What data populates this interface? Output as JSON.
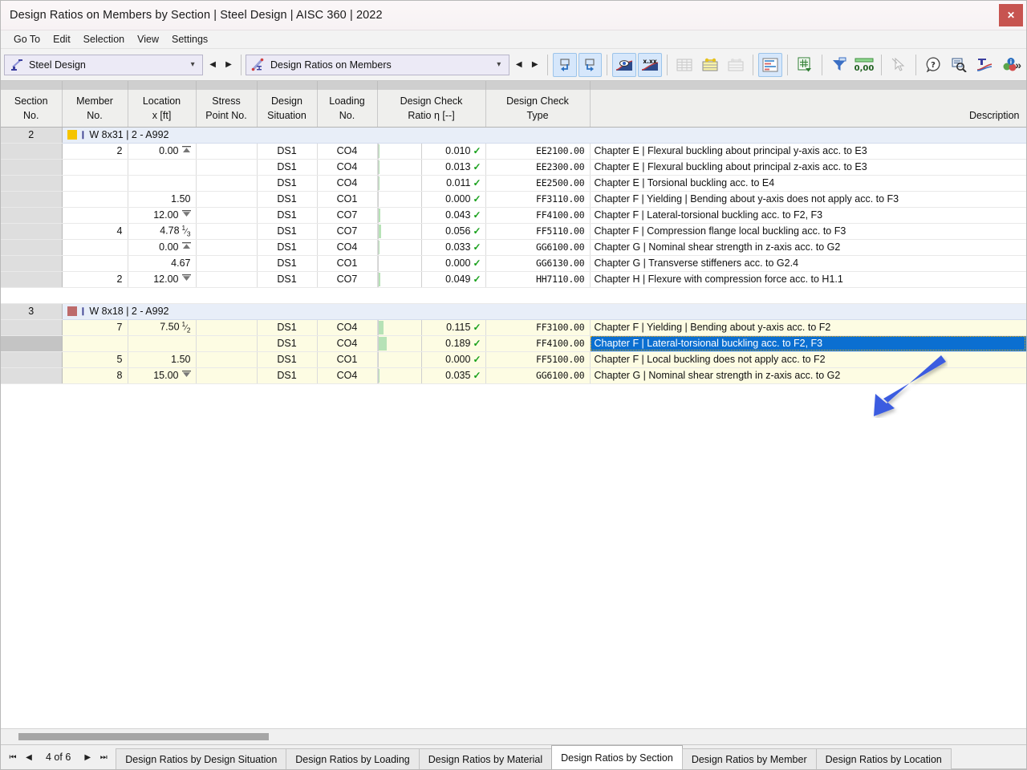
{
  "window": {
    "title": "Design Ratios on Members by Section | Steel Design | AISC 360 | 2022",
    "close_label": "✕"
  },
  "menu": {
    "items": [
      {
        "label": "Go To"
      },
      {
        "label": "Edit"
      },
      {
        "label": "Selection"
      },
      {
        "label": "View"
      },
      {
        "label": "Settings"
      }
    ]
  },
  "toolbar": {
    "combo_module": {
      "value": "Steel Design",
      "icon": "steel-beam-icon"
    },
    "combo_table": {
      "value": "Design Ratios on Members",
      "icon": "design-ratio-icon"
    },
    "overflow_label": "»",
    "buttons": [
      {
        "name": "restore-previous-icon",
        "active": true
      },
      {
        "name": "restore-next-icon",
        "active": true
      },
      {
        "name": "show-results-icon",
        "active": true
      },
      {
        "name": "show-values-icon",
        "active": true
      },
      {
        "name": "table-plain-icon",
        "active": false
      },
      {
        "name": "table-highlight-icon",
        "active": false
      },
      {
        "name": "table-grey-icon",
        "active": false
      },
      {
        "name": "bar-chart-icon",
        "active": true
      },
      {
        "name": "export-excel-icon",
        "active": false
      },
      {
        "name": "filter-icon",
        "active": false
      },
      {
        "name": "decimal-places-icon",
        "active": false
      },
      {
        "name": "select-cursor-icon",
        "active": false
      },
      {
        "name": "help-icon",
        "active": false
      },
      {
        "name": "inspect-icon",
        "active": false
      },
      {
        "name": "section-view-icon",
        "active": false
      },
      {
        "name": "info-colors-icon",
        "active": false
      }
    ]
  },
  "table": {
    "columns": [
      {
        "key": "section",
        "line1": "Section",
        "line2": "No."
      },
      {
        "key": "member",
        "line1": "Member",
        "line2": "No."
      },
      {
        "key": "location",
        "line1": "Location",
        "line2": "x [ft]"
      },
      {
        "key": "stresspoint",
        "line1": "Stress",
        "line2": "Point No."
      },
      {
        "key": "situation",
        "line1": "Design",
        "line2": "Situation"
      },
      {
        "key": "loading",
        "line1": "Loading",
        "line2": "No."
      },
      {
        "key": "ratio",
        "line1": "Design Check",
        "line2": "Ratio η [--]"
      },
      {
        "key": "type",
        "line1": "Design Check",
        "line2": "Type"
      },
      {
        "key": "description",
        "line1": "",
        "line2": "Description"
      }
    ],
    "groups": [
      {
        "section_no": "2",
        "swatch": "#f5c400",
        "label": "W 8x31 | 2 - A992",
        "band": "bandA",
        "rows": [
          {
            "member": "2",
            "location": "0.00",
            "endmark": "start",
            "frac": "",
            "stresspoint": "",
            "situation": "DS1",
            "loading": "CO4",
            "bar": 1.0,
            "ratio": "0.010",
            "type": "EE2100.00",
            "description": "Chapter E | Flexural buckling about principal y-axis acc. to E3"
          },
          {
            "member": "",
            "location": "",
            "endmark": "",
            "frac": "",
            "stresspoint": "",
            "situation": "DS1",
            "loading": "CO4",
            "bar": 1.3,
            "ratio": "0.013",
            "type": "EE2300.00",
            "description": "Chapter E | Flexural buckling about principal z-axis acc. to E3"
          },
          {
            "member": "",
            "location": "",
            "endmark": "",
            "frac": "",
            "stresspoint": "",
            "situation": "DS1",
            "loading": "CO4",
            "bar": 1.1,
            "ratio": "0.011",
            "type": "EE2500.00",
            "description": "Chapter E | Torsional buckling acc. to E4"
          },
          {
            "member": "",
            "location": "1.50",
            "endmark": "",
            "frac": "",
            "stresspoint": "",
            "situation": "DS1",
            "loading": "CO1",
            "bar": 0.0,
            "ratio": "0.000",
            "type": "FF3110.00",
            "description": "Chapter F | Yielding | Bending about y-axis does not apply acc. to F3"
          },
          {
            "member": "",
            "location": "12.00",
            "endmark": "end",
            "frac": "",
            "stresspoint": "",
            "situation": "DS1",
            "loading": "CO7",
            "bar": 4.3,
            "ratio": "0.043",
            "type": "FF4100.00",
            "description": "Chapter F | Lateral-torsional buckling acc. to F2, F3"
          },
          {
            "member": "4",
            "location": "4.78",
            "endmark": "",
            "frac": "1/3",
            "stresspoint": "",
            "situation": "DS1",
            "loading": "CO7",
            "bar": 5.6,
            "ratio": "0.056",
            "type": "FF5110.00",
            "description": "Chapter F | Compression flange local buckling acc. to F3"
          },
          {
            "member": "",
            "location": "0.00",
            "endmark": "start",
            "frac": "",
            "stresspoint": "",
            "situation": "DS1",
            "loading": "CO4",
            "bar": 3.3,
            "ratio": "0.033",
            "type": "GG6100.00",
            "description": "Chapter G | Nominal shear strength in z-axis acc. to G2"
          },
          {
            "member": "",
            "location": "4.67",
            "endmark": "",
            "frac": "",
            "stresspoint": "",
            "situation": "DS1",
            "loading": "CO1",
            "bar": 0.0,
            "ratio": "0.000",
            "type": "GG6130.00",
            "description": "Chapter G | Transverse stiffeners acc. to G2.4"
          },
          {
            "member": "2",
            "location": "12.00",
            "endmark": "end",
            "frac": "",
            "stresspoint": "",
            "situation": "DS1",
            "loading": "CO7",
            "bar": 4.9,
            "ratio": "0.049",
            "type": "HH7110.00",
            "description": "Chapter H | Flexure with compression force acc. to H1.1"
          }
        ]
      },
      {
        "section_no": "3",
        "swatch": "#bd6b6b",
        "label": "W 8x18 | 2 - A992",
        "band": "bandB",
        "rows": [
          {
            "member": "7",
            "location": "7.50",
            "endmark": "",
            "frac": "1/2",
            "stresspoint": "",
            "situation": "DS1",
            "loading": "CO4",
            "bar": 11.5,
            "ratio": "0.115",
            "type": "FF3100.00",
            "description": "Chapter F | Yielding | Bending about y-axis acc. to F2",
            "selected": false
          },
          {
            "member": "",
            "location": "",
            "endmark": "",
            "frac": "",
            "stresspoint": "",
            "situation": "DS1",
            "loading": "CO4",
            "bar": 18.9,
            "ratio": "0.189",
            "type": "FF4100.00",
            "description": "Chapter F | Lateral-torsional buckling acc. to F2, F3",
            "selected": true
          },
          {
            "member": "5",
            "location": "1.50",
            "endmark": "",
            "frac": "",
            "stresspoint": "",
            "situation": "DS1",
            "loading": "CO1",
            "bar": 0.0,
            "ratio": "0.000",
            "type": "FF5100.00",
            "description": "Chapter F | Local buckling does not apply acc. to F2",
            "selected": false
          },
          {
            "member": "8",
            "location": "15.00",
            "endmark": "end",
            "frac": "",
            "stresspoint": "",
            "situation": "DS1",
            "loading": "CO4",
            "bar": 3.5,
            "ratio": "0.035",
            "type": "GG6100.00",
            "description": "Chapter G | Nominal shear strength in z-axis acc. to G2",
            "selected": false
          }
        ]
      }
    ]
  },
  "annotation": {
    "arrow_color": "#3b5ce0",
    "points_to": "selected-description-row"
  },
  "status": {
    "page_label": "4 of 6",
    "first_label": "⏮",
    "prev_label": "◀",
    "next_label": "▶",
    "last_label": "⏭",
    "tabs": [
      {
        "label": "Design Ratios by Design Situation",
        "active": false
      },
      {
        "label": "Design Ratios by Loading",
        "active": false
      },
      {
        "label": "Design Ratios by Material",
        "active": false
      },
      {
        "label": "Design Ratios by Section",
        "active": true
      },
      {
        "label": "Design Ratios by Member",
        "active": false
      },
      {
        "label": "Design Ratios by Location",
        "active": false
      }
    ]
  },
  "colors": {
    "selection_blue": "#0b6fd1",
    "bar_green": "#b6e2b6",
    "check_green": "#17a01a",
    "band_yellow": "#fdfce3",
    "group_blue": "#e8eef8"
  }
}
